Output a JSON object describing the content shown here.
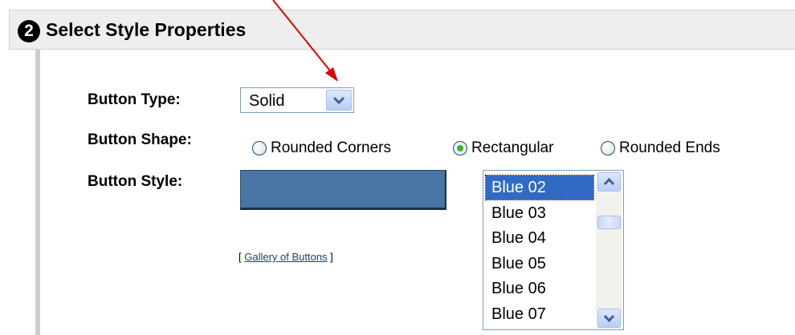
{
  "section": {
    "step_number": "2",
    "title": "Select Style Properties"
  },
  "button_type": {
    "label": "Button Type:",
    "selected": "Solid"
  },
  "button_shape": {
    "label": "Button Shape:",
    "options": [
      {
        "label": "Rounded Corners",
        "checked": false
      },
      {
        "label": "Rectangular",
        "checked": true
      },
      {
        "label": "Rounded Ends",
        "checked": false
      }
    ]
  },
  "button_style": {
    "label": "Button Style:",
    "preview_color": "#4875a4",
    "gallery_prefix": "[ ",
    "gallery_link": "Gallery of Buttons",
    "gallery_suffix": " ]",
    "list_items": [
      "Blue 02",
      "Blue 03",
      "Blue 04",
      "Blue 05",
      "Blue 06",
      "Blue 07"
    ],
    "selected_item": "Blue 02"
  },
  "colors": {
    "annotation_arrow": "#e00000",
    "selection": "#316ac5",
    "header_bg": "#eeeeee"
  }
}
